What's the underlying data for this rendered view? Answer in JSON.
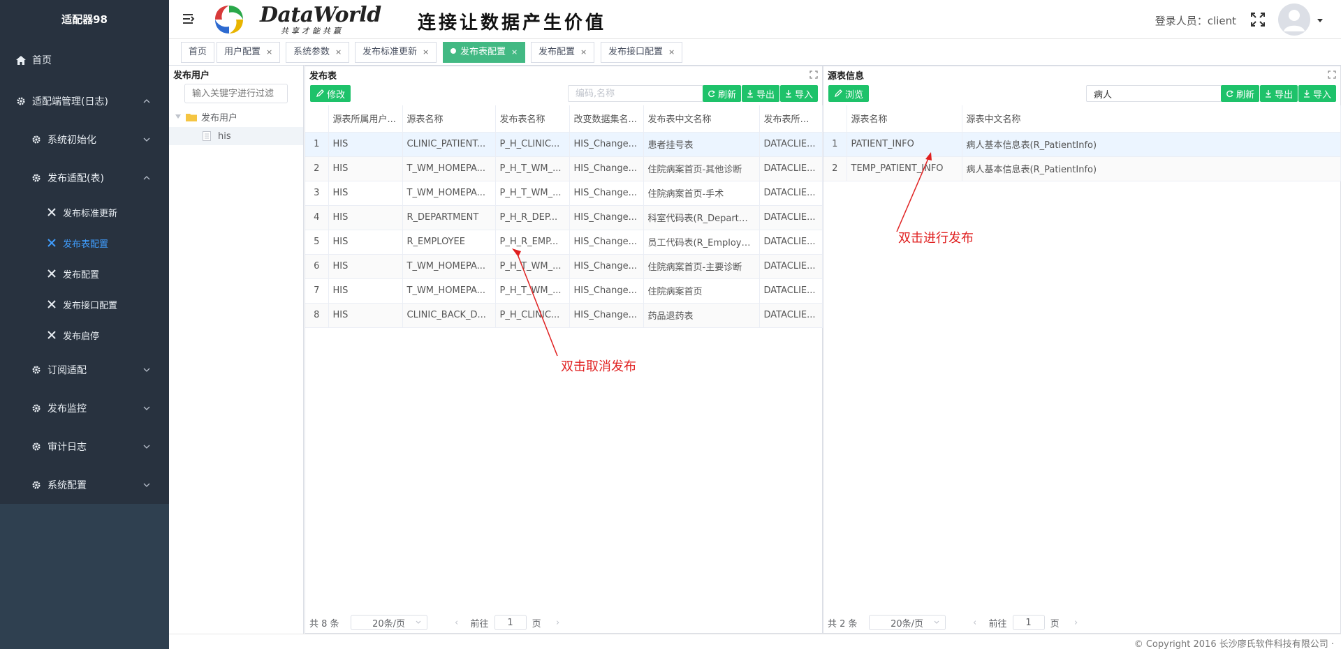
{
  "sidebar": {
    "title": "适配器98",
    "items": [
      {
        "label": "首页"
      },
      {
        "label": "适配端管理(日志)"
      },
      {
        "label": "系统初始化"
      },
      {
        "label": "发布适配(表)"
      },
      {
        "label": "发布标准更新"
      },
      {
        "label": "发布表配置"
      },
      {
        "label": "发布配置"
      },
      {
        "label": "发布接口配置"
      },
      {
        "label": "发布启停"
      },
      {
        "label": "订阅适配"
      },
      {
        "label": "发布监控"
      },
      {
        "label": "审计日志"
      },
      {
        "label": "系统配置"
      }
    ]
  },
  "header": {
    "brand": "DataWorld",
    "brand_sub": "共享才能共赢",
    "slogan": "连接让数据产生价值",
    "login_label": "登录人员：client"
  },
  "tabs": [
    {
      "label": "首页",
      "closable": false
    },
    {
      "label": "用户配置",
      "closable": true
    },
    {
      "label": "系统参数",
      "closable": true
    },
    {
      "label": "发布标准更新",
      "closable": true
    },
    {
      "label": "发布表配置",
      "closable": true,
      "active": true
    },
    {
      "label": "发布配置",
      "closable": true
    },
    {
      "label": "发布接口配置",
      "closable": true
    }
  ],
  "tree_panel": {
    "title": "发布用户",
    "filter_placeholder": "输入关键字进行过滤",
    "root": "发布用户",
    "child": "his"
  },
  "publish_panel": {
    "title": "发布表",
    "edit_button": "修改",
    "search_placeholder": "编码,名称",
    "refresh": "刷新",
    "export": "导出",
    "import": "导入",
    "columns": [
      "源表所属用户...",
      "源表名称",
      "发布表名称",
      "改变数据集名...",
      "发布表中文名称",
      "发布表所属..."
    ],
    "rows": [
      [
        "1",
        "HIS",
        "CLINIC_PATIENT...",
        "P_H_CLINIC...",
        "HIS_Change...",
        "患者挂号表",
        "DATACLIE..."
      ],
      [
        "2",
        "HIS",
        "T_WM_HOMEPA...",
        "P_H_T_WM_...",
        "HIS_Change...",
        "住院病案首页-其他诊断",
        "DATACLIE..."
      ],
      [
        "3",
        "HIS",
        "T_WM_HOMEPA...",
        "P_H_T_WM_...",
        "HIS_Change...",
        "住院病案首页-手术",
        "DATACLIE..."
      ],
      [
        "4",
        "HIS",
        "R_DEPARTMENT",
        "P_H_R_DEP...",
        "HIS_Change...",
        "科室代码表(R_Departm...",
        "DATACLIE..."
      ],
      [
        "5",
        "HIS",
        "R_EMPLOYEE",
        "P_H_R_EMP...",
        "HIS_Change...",
        "员工代码表(R_Employee)",
        "DATACLIE..."
      ],
      [
        "6",
        "HIS",
        "T_WM_HOMEPA...",
        "P_H_T_WM_...",
        "HIS_Change...",
        "住院病案首页-主要诊断",
        "DATACLIE..."
      ],
      [
        "7",
        "HIS",
        "T_WM_HOMEPA...",
        "P_H_T_WM_...",
        "HIS_Change...",
        "住院病案首页",
        "DATACLIE..."
      ],
      [
        "8",
        "HIS",
        "CLINIC_BACK_D...",
        "P_H_CLINIC...",
        "HIS_Change...",
        "药品退药表",
        "DATACLIE..."
      ]
    ],
    "pager": {
      "total": "共 8 条",
      "size": "20条/页",
      "goto": "前往",
      "page": "1",
      "page_suffix": "页"
    }
  },
  "source_panel": {
    "title": "源表信息",
    "browse_button": "浏览",
    "search_value": "病人",
    "refresh": "刷新",
    "export": "导出",
    "import": "导入",
    "columns": [
      "源表名称",
      "源表中文名称"
    ],
    "rows": [
      [
        "1",
        "PATIENT_INFO",
        "病人基本信息表(R_PatientInfo)"
      ],
      [
        "2",
        "TEMP_PATIENT_INFO",
        "病人基本信息表(R_PatientInfo)"
      ]
    ],
    "pager": {
      "total": "共 2 条",
      "size": "20条/页",
      "goto": "前往",
      "page": "1",
      "page_suffix": "页"
    }
  },
  "annotations": {
    "cancel": "双击取消发布",
    "publish": "双击进行发布"
  },
  "footer": "© Copyright 2016 长沙廖氏软件科技有限公司 ·",
  "colors": {
    "sidebar_bg": "#28323f",
    "active_blue": "#409eff",
    "green": "#1ec26a",
    "active_tab": "#42b983",
    "annotation_red": "#e02020"
  }
}
